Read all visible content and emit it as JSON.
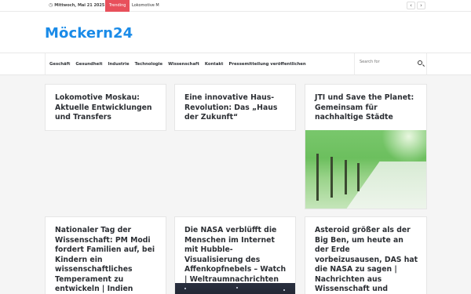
{
  "topbar": {
    "date": "Mittwoch, Mai 21 2025",
    "trending_label": "Trending",
    "ticker_text": "Lokomotive M",
    "prev_label": "‹",
    "next_label": "›"
  },
  "site": {
    "logo": "Möckern24",
    "brand_color": "#1a8be8",
    "accent_color": "#e8505b"
  },
  "nav": {
    "items": [
      "Geschäft",
      "Gesundheit",
      "Industrie",
      "Technologie",
      "Wissenschaft",
      "Kontakt",
      "Pressemitteilung veröffentlichen"
    ],
    "search_placeholder": "Search for"
  },
  "articles": [
    {
      "title": "Lokomotive Moskau: Aktuelle Entwicklungen und Transfers"
    },
    {
      "title": "Eine innovative Haus-Revolution: Das „Haus der Zukunft“"
    },
    {
      "title": "JTI und Save the Planet: Gemeinsam für nachhaltige Städte"
    },
    {
      "title": "Nationaler Tag der Wissenschaft: PM Modi fordert Familien auf, bei Kindern ein wissenschaftliches Temperament zu entwickeln | Indien"
    },
    {
      "title": "Die NASA verblüfft die Menschen im Internet mit Hubble-Visualisierung des Affenkopfnebels – Watch | Weltraumnachrichten"
    },
    {
      "title": "Asteroid größer als der Big Ben, um heute an der Erde vorbeizusausen, DAS hat die NASA zu sagen | Nachrichten aus Wissenschaft und Umwelt"
    }
  ]
}
